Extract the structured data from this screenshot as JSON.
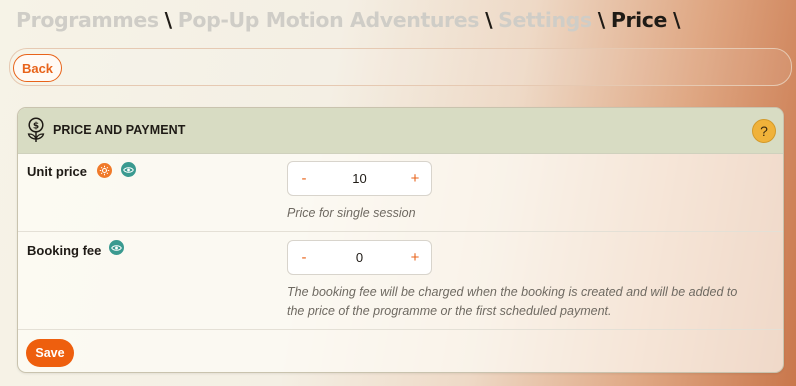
{
  "breadcrumb": {
    "items": [
      "Programmes",
      "Pop-Up Motion Adventures",
      "Settings",
      "Price"
    ],
    "separator": "\\"
  },
  "toolbar": {
    "back_label": "Back"
  },
  "section": {
    "title": "PRICE AND PAYMENT",
    "icon": "money-plant-icon",
    "help_label": "?"
  },
  "fields": {
    "unit_price": {
      "label": "Unit price",
      "icons": [
        "settings-sun-icon",
        "eye-icon"
      ],
      "value": "10",
      "minus": "-",
      "plus": "+",
      "hint": "Price for single session"
    },
    "booking_fee": {
      "label": "Booking fee",
      "icons": [
        "eye-icon"
      ],
      "value": "0",
      "minus": "-",
      "plus": "+",
      "hint_line1": "The booking fee will be charged when the booking is created and will be added to",
      "hint_line2": "the price of the programme or the first scheduled payment."
    }
  },
  "actions": {
    "save_label": "Save"
  },
  "colors": {
    "accent": "#e8631a",
    "header_bg": "#d8dcc3",
    "help": "#f0b23a",
    "orange_badge": "#f07a2a",
    "teal_badge": "#3a9a90"
  }
}
